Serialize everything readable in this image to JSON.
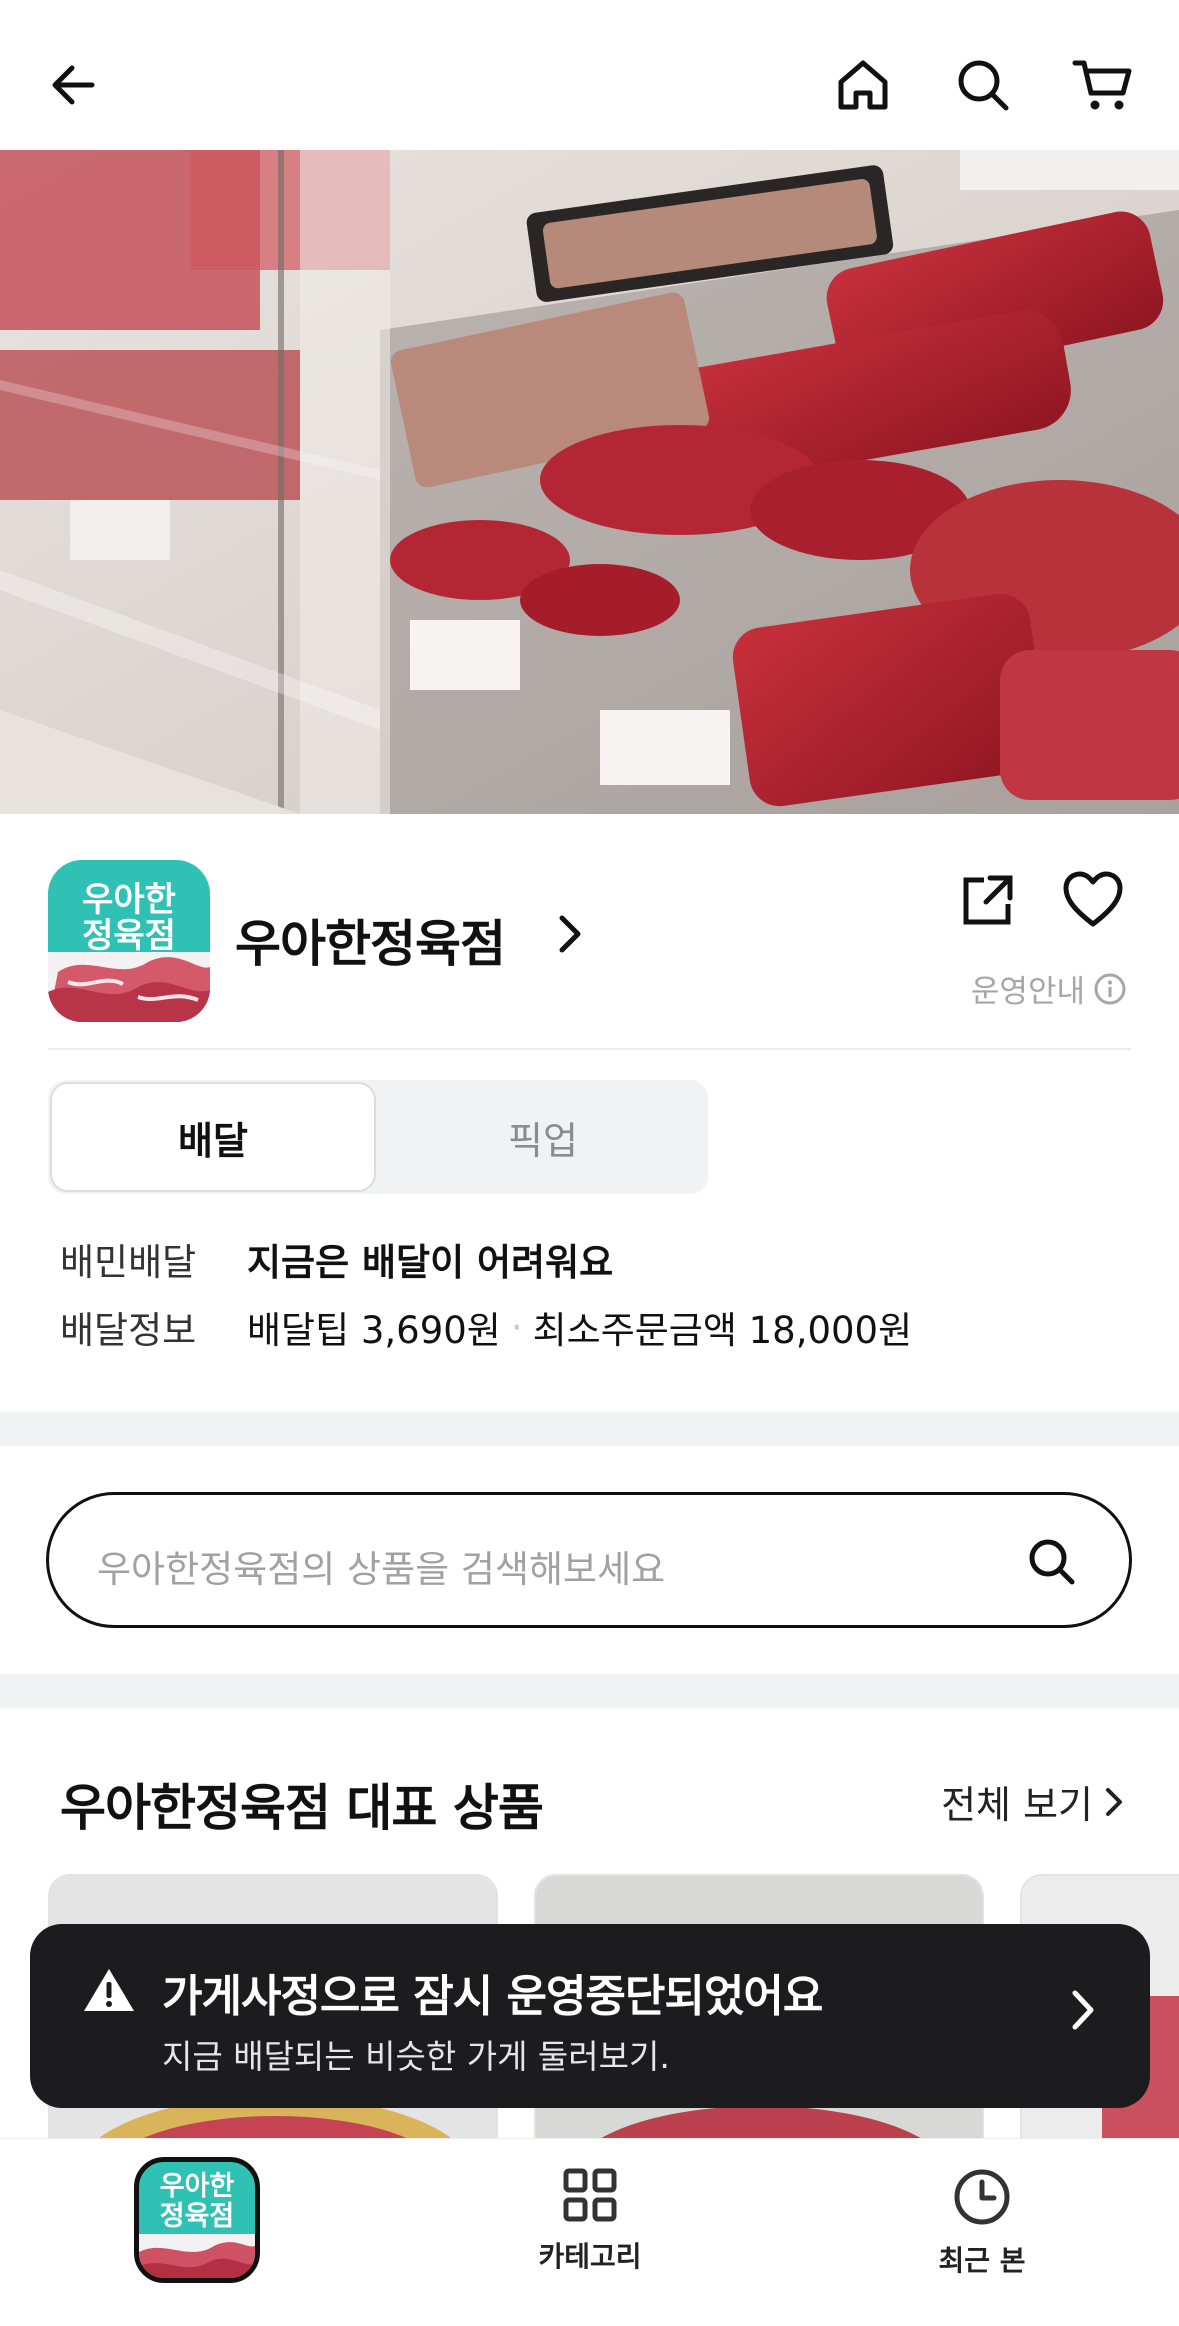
{
  "topbar": {
    "back_icon": "arrow-left-icon",
    "home_icon": "home-icon",
    "search_icon": "search-icon",
    "cart_icon": "cart-icon"
  },
  "hero": {
    "description_icon": "meat-display-photo"
  },
  "store": {
    "logo_line1": "우아한",
    "logo_line2": "정육점",
    "name": "우아한정육점",
    "operation_info": "운영안내"
  },
  "order_type": {
    "options": [
      "배달",
      "픽업"
    ],
    "selected": "배달"
  },
  "delivery": {
    "row1_label": "배민배달",
    "row1_value": "지금은 배달이 어려워요",
    "row2_label": "배달정보",
    "row2_tip": "배달팁 3,690원",
    "row2_min": "최소주문금액 18,000원"
  },
  "search": {
    "placeholder": "우아한정육점의 상품을 검색해보세요"
  },
  "featured": {
    "title": "우아한정육점 대표 상품",
    "see_all": "전체 보기"
  },
  "toast": {
    "title": "가게사정으로 잠시 운영중단되었어요",
    "subtitle": "지금 배달되는 비슷한 가게 둘러보기."
  },
  "tabbar": {
    "store_line1": "우아한",
    "store_line2": "정육점",
    "category_label": "카테고리",
    "recent_label": "최근 본"
  },
  "colors": {
    "brand_mint": "#2ec1b4",
    "toast_bg": "#1c1c1e",
    "section_gap": "#f1f2f4"
  }
}
